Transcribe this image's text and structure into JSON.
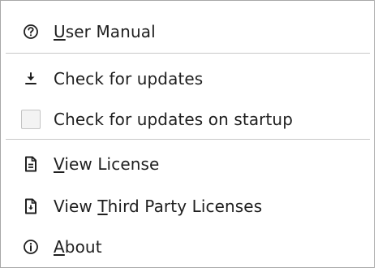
{
  "menu": {
    "items": [
      {
        "id": "user-manual",
        "pre": "",
        "mnemonic": "U",
        "post": "ser Manual",
        "icon": "help-circle-icon"
      },
      {
        "id": "check-updates",
        "pre": "Check for updates",
        "mnemonic": "",
        "post": "",
        "icon": "download-icon"
      },
      {
        "id": "check-updates-startup",
        "pre": "Check for updates on startup",
        "mnemonic": "",
        "post": "",
        "icon": "checkbox",
        "checked": false
      },
      {
        "id": "view-license",
        "pre": "",
        "mnemonic": "V",
        "post": "iew License",
        "icon": "document-icon"
      },
      {
        "id": "view-third-party",
        "pre": "View ",
        "mnemonic": "T",
        "post": "hird Party Licenses",
        "icon": "document-download-icon"
      },
      {
        "id": "about",
        "pre": "",
        "mnemonic": "A",
        "post": "bout",
        "icon": "info-circle-icon"
      }
    ]
  },
  "colors": {
    "text": "#1f1f1f",
    "border": "#a8a8a8",
    "separator": "#c8c8c8",
    "checkbox_bg": "#f3f3f3"
  }
}
